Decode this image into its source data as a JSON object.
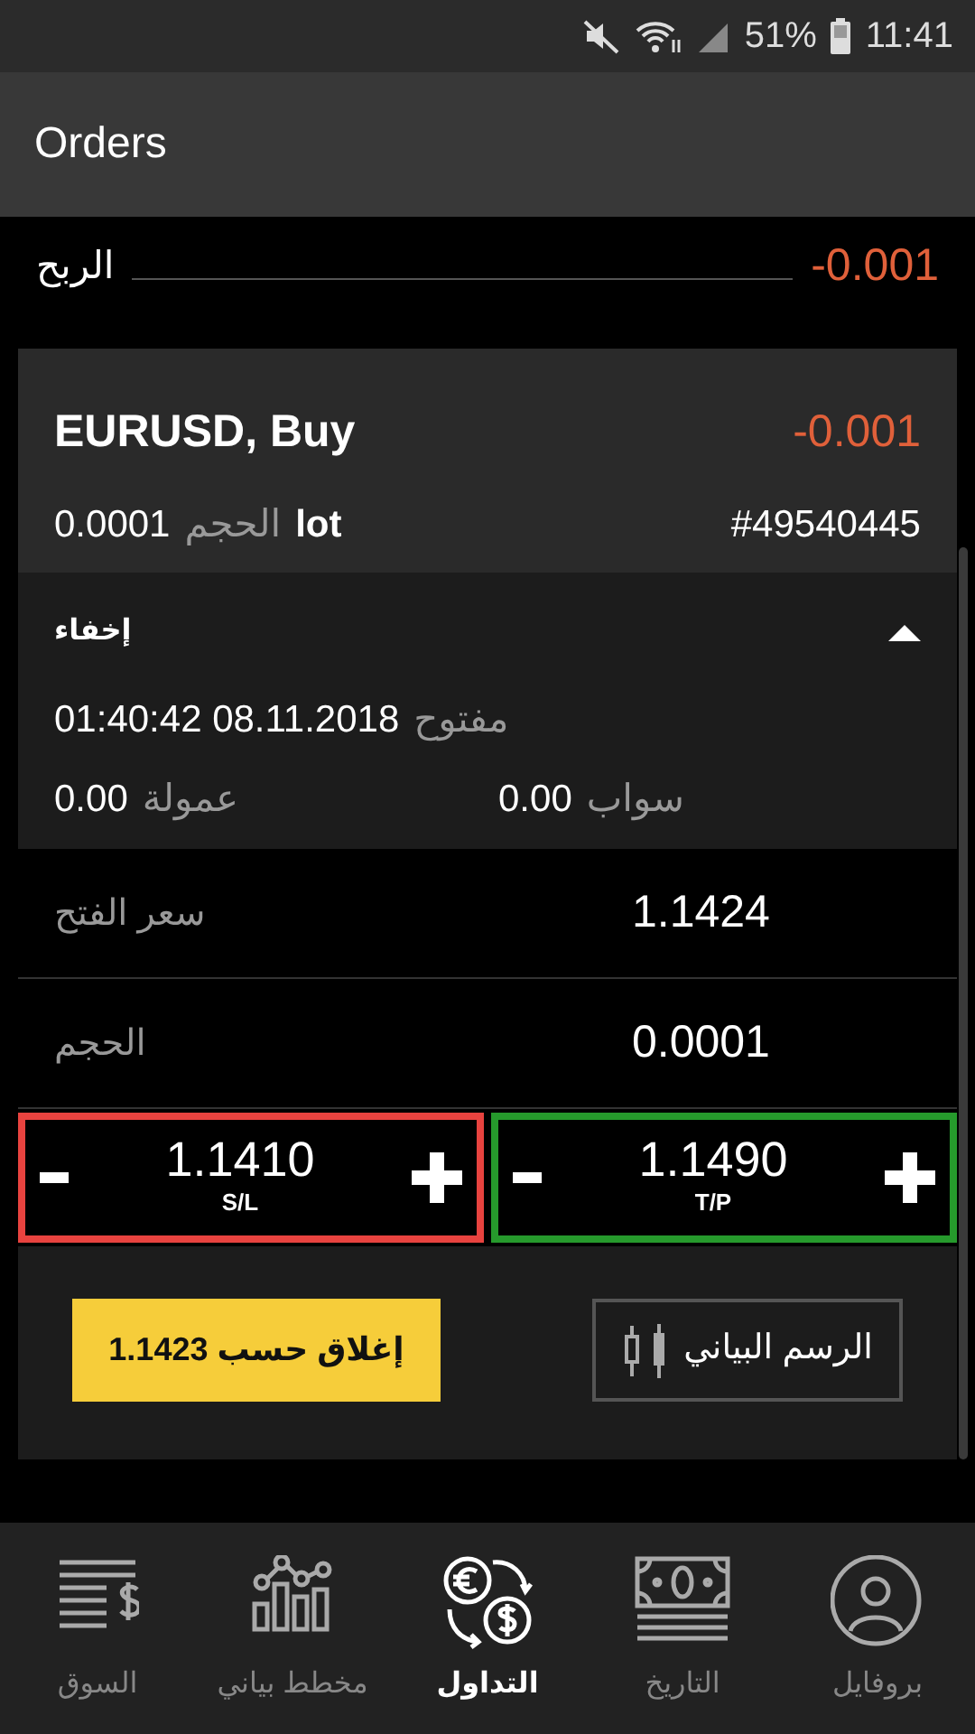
{
  "status_bar": {
    "battery": "51%",
    "time": "11:41"
  },
  "title": "Orders",
  "profit": {
    "label": "الربح",
    "value": "-0.001"
  },
  "order": {
    "symbol": "EURUSD, Buy",
    "profit": "-0.001",
    "volume_value": "0.0001",
    "volume_label": "الحجم",
    "volume_unit": "lot",
    "ticket": "#49540445"
  },
  "details": {
    "toggle_label": "إخفاء",
    "expanded": true,
    "opened": {
      "label": "مفتوح",
      "value": "01:40:42 08.11.2018"
    },
    "commission": {
      "label": "عمولة",
      "value": "0.00"
    },
    "swap": {
      "label": "سواب",
      "value": "0.00"
    }
  },
  "fields": [
    {
      "label": "سعر الفتح",
      "value": "1.1424"
    },
    {
      "label": "الحجم",
      "value": "0.0001"
    }
  ],
  "stops": [
    {
      "label": "T/P",
      "value": "1.1490",
      "color": "#269a2c"
    },
    {
      "label": "S/L",
      "value": "1.1410",
      "color": "#e8433f"
    }
  ],
  "close_button": "إغلاق حسب 1.1423",
  "chart_button": "الرسم البياني",
  "nav": [
    {
      "label": "بروفايل",
      "selected": false
    },
    {
      "label": "التاريخ",
      "selected": false
    },
    {
      "label": "التداول",
      "selected": true
    },
    {
      "label": "مخطط بياني",
      "selected": false
    },
    {
      "label": "السوق",
      "selected": false
    }
  ]
}
